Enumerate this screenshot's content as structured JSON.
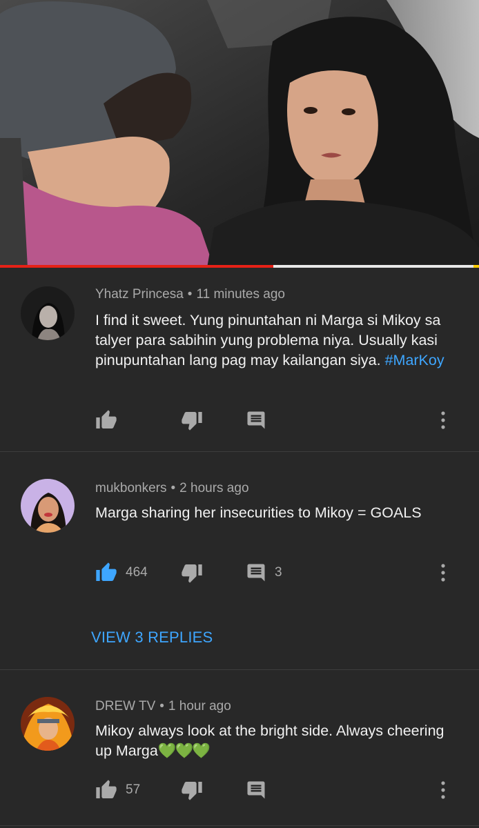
{
  "video": {
    "progress_played_fraction": 0.57
  },
  "comments": [
    {
      "author": "Yhatz Princesa",
      "separator": "•",
      "time": "11 minutes ago",
      "text": "I find it sweet. Yung pinuntahan ni Marga si Mikoy sa talyer para sabihin yung problema niya. Usually kasi pinupuntahan lang pag may kailangan siya.",
      "hashtag": "#MarKoy",
      "likes": "",
      "replies_count": ""
    },
    {
      "author": "mukbonkers",
      "separator": "•",
      "time": "2 hours ago",
      "text": "Marga sharing her insecurities to Mikoy = GOALS",
      "likes": "464",
      "replies_count": "3",
      "view_replies_label": "VIEW 3 REPLIES"
    },
    {
      "author": "DREW TV",
      "separator": "•",
      "time": "1 hour ago",
      "text": "Mikoy always look at the bright side. Always cheering up Marga",
      "emoji": "💚💚💚",
      "likes": "57",
      "replies_count": ""
    }
  ],
  "icons": {
    "like": "thumbs-up-icon",
    "dislike": "thumbs-down-icon",
    "reply": "reply-comment-icon",
    "more": "more-vert-icon"
  },
  "colors": {
    "background": "#282828",
    "progress": "#e62117",
    "link": "#3ea6ff",
    "liked": "#3ea6ff",
    "heart": "#8bd12f"
  }
}
